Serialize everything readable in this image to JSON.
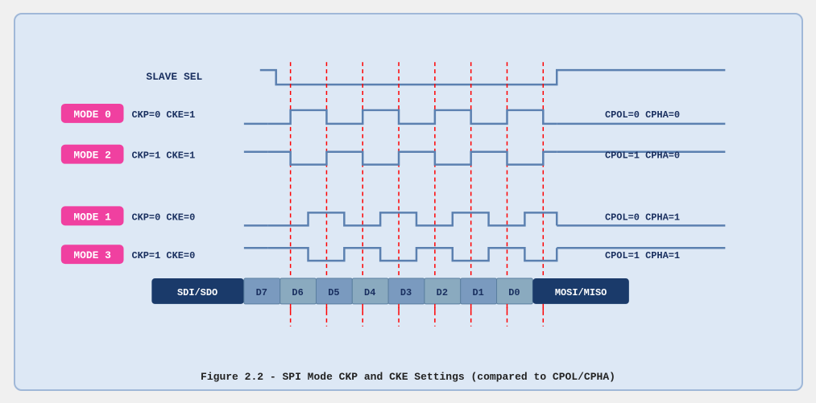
{
  "title": "Figure 2.2 - SPI Mode CKP and CKE Settings (compared to CPOL/CPHA)",
  "caption": "Figure 2.2 - SPI Mode CKP and CKE Settings (compared to CPOL/CPHA)",
  "diagram": {
    "slave_sel_label": "SLAVE SEL",
    "mode0_label": "MODE 0",
    "mode0_params": "CKP=0  CKE=1",
    "mode0_right": "CPOL=0  CPHA=0",
    "mode2_label": "MODE 2",
    "mode2_params": "CKP=1  CKE=1",
    "mode2_right": "CPOL=1  CPHA=0",
    "mode1_label": "MODE 1",
    "mode1_params": "CKP=0  CKE=0",
    "mode1_right": "CPOL=0  CPHA=1",
    "mode3_label": "MODE 3",
    "mode3_params": "CKP=1  CKE=0",
    "mode3_right": "CPOL=1  CPHA=1",
    "data_bits": [
      "SDI/SDO",
      "D7",
      "D6",
      "D5",
      "D4",
      "D3",
      "D2",
      "D1",
      "D0",
      "MOSI/MISO"
    ]
  }
}
